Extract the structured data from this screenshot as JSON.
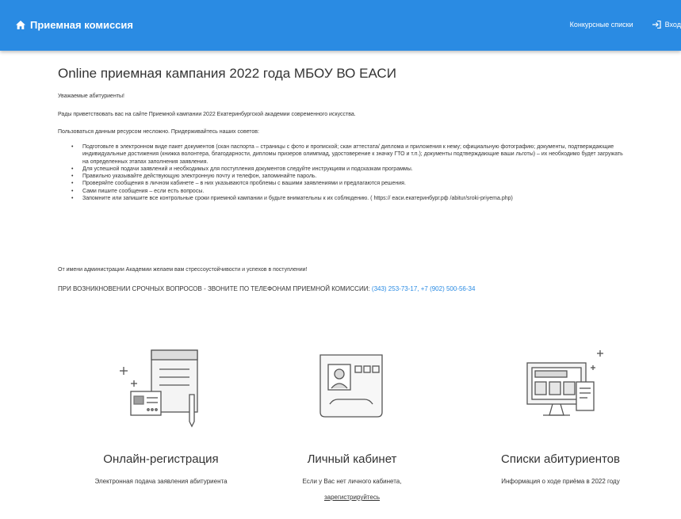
{
  "header": {
    "title": "Приемная комиссия",
    "nav": {
      "lists_label": "Конкурсные списки",
      "login_label": "Вход"
    },
    "colors": {
      "bar": "#2a8be3",
      "text": "#ffffff"
    },
    "icons": [
      "home-icon",
      "login-icon"
    ]
  },
  "main": {
    "title": "Online приемная кампания 2022 года МБОУ ВО ЕАСИ",
    "greeting": "Уважаемые абитуриенты!",
    "welcome": "Рады приветствовать вас на сайте Приемной кампании 2022 Екатеринбургской академии современного искусства.",
    "advice_intro": "Пользоваться данным ресурсом несложно. Придерживайтесь наших советов:",
    "tips": [
      "Подготовьте в электронном виде пакет документов (скан паспорта – страницы с фото и пропиской; скан аттестата/ диплома и приложения к нему; официальную фотографию; документы, подтверждающие индивидуальные достижения (книжка волонтера, благодарности, дипломы призеров олимпиад, удостоверение к значку ГТО и т.п.); документы подтверждающие ваши льготы) – их необходимо будет загружать на определенных этапах заполнения заявления.",
      "Для успешной подачи заявлений и необходимых для поступления документов следуйте инструкциям и подсказкам программы.",
      "Правильно указывайте действующую электронную почту и телефон, запоминайте пароль.",
      "Проверяйте сообщения в личном кабинете – в них указываются проблемы с вашими заявлениями и предлагаются решения.",
      "Сами пишите сообщения – если есть вопросы.",
      "Запомните или запишите все контрольные сроки приемной кампании и будьте внимательны к их соблюдению. ( https:// еаси.екатеринбург.рф /abitur/sroki-priyema.php)"
    ],
    "closing": "От имени администрации Академии желаем вам стрессоустойчивости и успехов в поступлении!",
    "urgent_prefix": "ПРИ ВОЗНИКНОВЕНИИ СРОЧНЫХ ВОПРОСОВ - ЗВОНИТЕ ПО ТЕЛЕФОНАМ ПРИЕМНОЙ КОМИССИИ:",
    "phones": "(343) 253-73-17, +7 (902) 500-56-34",
    "link_color": "#2a8be3"
  },
  "cards": [
    {
      "title": "Онлайн-регистрация",
      "description": "Электронная подача заявления абитуриента",
      "icon": "online-registration-illustration"
    },
    {
      "title": "Личный кабинет",
      "description": "Если у Вас нет личного кабинета,",
      "link": "зарегистрируйтесь",
      "icon": "personal-account-illustration"
    },
    {
      "title": "Списки абитуриентов",
      "description": "Информация о ходе приёма в 2022 году",
      "icon": "applicant-lists-illustration"
    }
  ]
}
